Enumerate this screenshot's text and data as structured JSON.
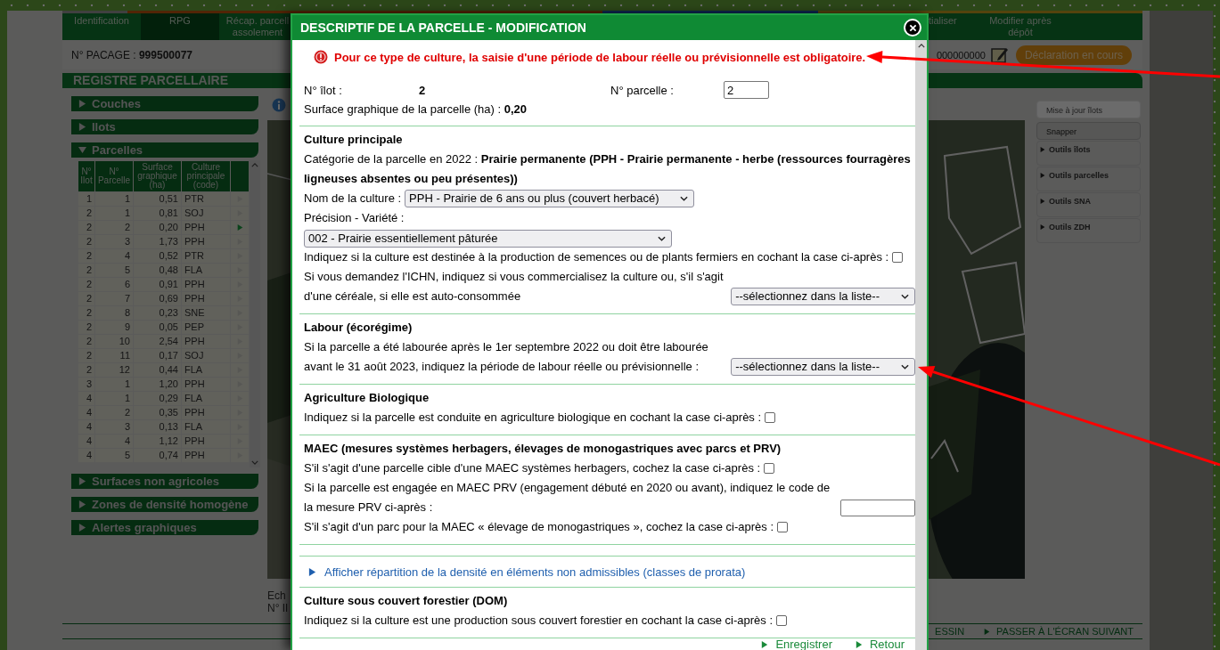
{
  "tabs": [
    {
      "label": "Identification",
      "selected": false
    },
    {
      "label": "RPG",
      "selected": true
    },
    {
      "label": "Récap. parcell\nassolement",
      "selected": false
    }
  ],
  "tabs_right": [
    {
      "label": "tialiser",
      "selected": false
    },
    {
      "label": "Modifier après\ndépôt",
      "selected": false
    }
  ],
  "pacage": {
    "label": "N° PACAGE :",
    "value": "999500077"
  },
  "dossier_number": "000000000",
  "status": "Déclaration en cours",
  "registre_title": "REGISTRE PARCELLAIRE",
  "panels_top": [
    {
      "label": "Couches",
      "expanded": false
    },
    {
      "label": "Ilots",
      "expanded": false
    },
    {
      "label": "Parcelles",
      "expanded": true
    }
  ],
  "parcel_table": {
    "columns": [
      "N°\nIlot",
      "N°\nParcelle",
      "Surface\ngraphique\n(ha)",
      "Culture\nprincipale\n(code)"
    ],
    "rows": [
      {
        "ilot": "1",
        "parcelle": "1",
        "surface": "0,51",
        "code": "PTR",
        "selected": false
      },
      {
        "ilot": "2",
        "parcelle": "1",
        "surface": "0,81",
        "code": "SOJ",
        "selected": false
      },
      {
        "ilot": "2",
        "parcelle": "2",
        "surface": "0,20",
        "code": "PPH",
        "selected": true
      },
      {
        "ilot": "2",
        "parcelle": "3",
        "surface": "1,73",
        "code": "PPH",
        "selected": false
      },
      {
        "ilot": "2",
        "parcelle": "4",
        "surface": "0,52",
        "code": "PTR",
        "selected": false
      },
      {
        "ilot": "2",
        "parcelle": "5",
        "surface": "0,48",
        "code": "FLA",
        "selected": false
      },
      {
        "ilot": "2",
        "parcelle": "6",
        "surface": "0,91",
        "code": "PPH",
        "selected": false
      },
      {
        "ilot": "2",
        "parcelle": "7",
        "surface": "0,69",
        "code": "PPH",
        "selected": false
      },
      {
        "ilot": "2",
        "parcelle": "8",
        "surface": "0,23",
        "code": "SNE",
        "selected": false
      },
      {
        "ilot": "2",
        "parcelle": "9",
        "surface": "0,05",
        "code": "PEP",
        "selected": false
      },
      {
        "ilot": "2",
        "parcelle": "10",
        "surface": "2,54",
        "code": "PPH",
        "selected": false
      },
      {
        "ilot": "2",
        "parcelle": "11",
        "surface": "0,17",
        "code": "SOJ",
        "selected": false
      },
      {
        "ilot": "2",
        "parcelle": "12",
        "surface": "0,44",
        "code": "FLA",
        "selected": false
      },
      {
        "ilot": "3",
        "parcelle": "1",
        "surface": "1,20",
        "code": "PPH",
        "selected": false
      },
      {
        "ilot": "4",
        "parcelle": "1",
        "surface": "0,29",
        "code": "FLA",
        "selected": false
      },
      {
        "ilot": "4",
        "parcelle": "2",
        "surface": "0,35",
        "code": "PPH",
        "selected": false
      },
      {
        "ilot": "4",
        "parcelle": "3",
        "surface": "0,13",
        "code": "FLA",
        "selected": false
      },
      {
        "ilot": "4",
        "parcelle": "4",
        "surface": "1,12",
        "code": "PPH",
        "selected": false
      },
      {
        "ilot": "4",
        "parcelle": "5",
        "surface": "0,74",
        "code": "PPH",
        "selected": false
      }
    ]
  },
  "panels_bottom": [
    {
      "label": "Surfaces non agricoles",
      "expanded": false
    },
    {
      "label": "Zones de densité homogène",
      "expanded": false
    },
    {
      "label": "Alertes graphiques",
      "expanded": false
    }
  ],
  "map_footer": [
    "Ech",
    "N° Il"
  ],
  "tools": [
    {
      "kind": "button",
      "label": "Mise à jour îlots",
      "disabled": true
    },
    {
      "kind": "button",
      "label": "Snapper",
      "disabled": false
    },
    {
      "kind": "group",
      "label": "Outils îlots"
    },
    {
      "kind": "group",
      "label": "Outils parcelles"
    },
    {
      "kind": "group",
      "label": "Outils SNA"
    },
    {
      "kind": "group",
      "label": "Outils ZDH"
    }
  ],
  "bottom_links": [
    {
      "kind": "plain",
      "label": "ESSIN"
    },
    {
      "kind": "link",
      "label": "PASSER À L'ÉCRAN SUIVANT"
    }
  ],
  "modal": {
    "title": "DESCRIPTIF DE LA PARCELLE - MODIFICATION",
    "error": "Pour ce type de culture, la saisie d'une période de labour réelle ou prévisionnelle est obligatoire.",
    "ilot_label": "N° îlot :",
    "ilot_value": "2",
    "parcelle_label": "N° parcelle :",
    "parcelle_value": "2",
    "surface": "Surface graphique de la parcelle (ha) : **0,20**",
    "blocks": [
      {
        "kind": "section",
        "title": "Culture principale",
        "rows": [
          {
            "kind": "text",
            "text": "Catégorie de la parcelle en 2022 : **Prairie permanente (PPH - Prairie permanente - herbe (ressources fourragères ligneuses absentes ou peu présentes))**"
          },
          {
            "kind": "select",
            "label": "Nom de la culture :",
            "value": "PPH - Prairie de 6 ans ou plus (couvert herbacé)"
          },
          {
            "kind": "label_select",
            "label": "Précision - Variété :",
            "value": "002 - Prairie essentiellement pâturée"
          },
          {
            "kind": "checkbox",
            "label": "Indiquez si la culture est destinée à la production de semences ou de plants fermiers en cochant la case ci-après :",
            "checked": false
          },
          {
            "kind": "select",
            "label": "Si vous demandez l'ICHN, indiquez si vous commercialisez la culture ou, s'il s'agit d'une céréale, si elle est auto-consommée",
            "value": "--sélectionnez dans la liste--"
          }
        ]
      },
      {
        "kind": "section",
        "title": "Labour (écorégime)",
        "rows": [
          {
            "kind": "select",
            "label": "Si la parcelle a été labourée après le 1er septembre 2022 ou doit être labourée avant le 31 août 2023, indiquez la période de labour réelle ou prévisionnelle :",
            "value": "--sélectionnez dans la liste--"
          }
        ]
      },
      {
        "kind": "section",
        "title": "Agriculture Biologique",
        "rows": [
          {
            "kind": "checkbox",
            "label": "Indiquez si la parcelle est conduite en agriculture biologique en cochant la case ci-après :",
            "checked": false
          }
        ]
      },
      {
        "kind": "section",
        "title": "MAEC (mesures systèmes herbagers, élevages de monogastriques avec parcs et PRV)",
        "rows": [
          {
            "kind": "checkbox",
            "label": "S'il s'agit d'une parcelle cible d'une MAEC systèmes herbagers, cochez la case ci-après :",
            "checked": false
          },
          {
            "kind": "input",
            "label": "Si la parcelle est engagée en MAEC PRV (engagement débuté en 2020 ou avant), indiquez le code de la mesure PRV ci-après :"
          },
          {
            "kind": "checkbox",
            "label": "S'il s'agit d'un parc pour la MAEC « élevage de monogastriques », cochez la case ci-après :",
            "checked": false
          }
        ]
      },
      {
        "kind": "link",
        "text": "Afficher répartition de la densité en éléments non admissibles (classes de prorata)"
      },
      {
        "kind": "section",
        "title": "Culture sous couvert forestier (DOM)",
        "rows": [
          {
            "kind": "checkbox",
            "label": "Indiquez si la culture est une production sous couvert forestier en cochant la case ci-après :",
            "checked": false
          }
        ]
      }
    ],
    "footer_links": [
      "Enregistrer",
      "Retour"
    ]
  }
}
